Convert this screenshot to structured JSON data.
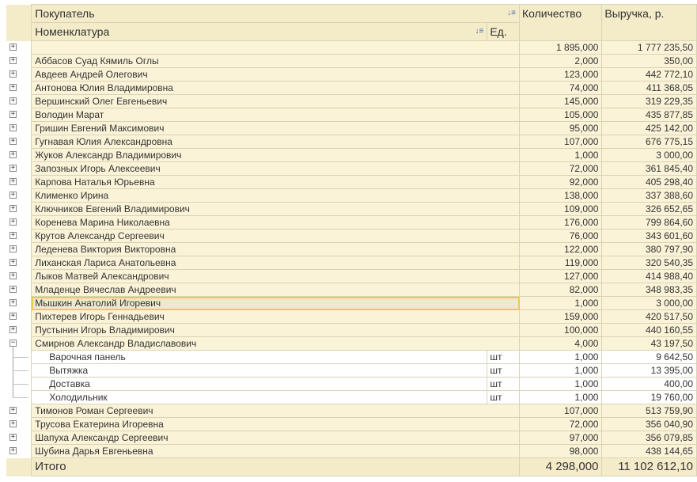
{
  "header": {
    "buyer": "Покупатель",
    "item": "Номенклатура",
    "unit": "Ед.",
    "qty": "Количество",
    "revenue": "Выручка, р."
  },
  "top_row": {
    "qty": "1 895,000",
    "revenue": "1 777 235,50"
  },
  "groups_before": [
    {
      "name": "Аббасов Суад Кямиль Оглы",
      "qty": "2,000",
      "revenue": "350,00"
    },
    {
      "name": "Авдеев Андрей Олегович",
      "qty": "123,000",
      "revenue": "442 772,10"
    },
    {
      "name": "Антонова Юлия Владимировна",
      "qty": "74,000",
      "revenue": "411 368,05"
    },
    {
      "name": "Вершинский Олег Евгеньевич",
      "qty": "145,000",
      "revenue": "319 229,35"
    },
    {
      "name": "Володин Марат",
      "qty": "105,000",
      "revenue": "435 877,85"
    },
    {
      "name": "Гришин Евгений Максимович",
      "qty": "95,000",
      "revenue": "425 142,00"
    },
    {
      "name": "Гугнавая Юлия Александровна",
      "qty": "107,000",
      "revenue": "676 775,15"
    },
    {
      "name": "Жуков Александр Владимирович",
      "qty": "1,000",
      "revenue": "3 000,00"
    },
    {
      "name": "Запозных Игорь Алексеевич",
      "qty": "72,000",
      "revenue": "361 845,40"
    },
    {
      "name": "Карпова Наталья Юрьевна",
      "qty": "92,000",
      "revenue": "405 298,40"
    },
    {
      "name": "Клименко Ирина",
      "qty": "138,000",
      "revenue": "337 388,60"
    },
    {
      "name": "Ключников Евгений Владимирович",
      "qty": "109,000",
      "revenue": "326 652,65"
    },
    {
      "name": "Коренева Марина Николаевна",
      "qty": "176,000",
      "revenue": "799 864,60"
    },
    {
      "name": "Крутов Александр Сергеевич",
      "qty": "76,000",
      "revenue": "343 601,60"
    },
    {
      "name": "Леденева Виктория Викторовна",
      "qty": "122,000",
      "revenue": "380 797,90"
    },
    {
      "name": "Лиханская Лариса Анатольевна",
      "qty": "119,000",
      "revenue": "320 540,35"
    },
    {
      "name": "Лыков Матвей Александрович",
      "qty": "127,000",
      "revenue": "414 988,40"
    },
    {
      "name": "Младенце Вячеслав Андреевич",
      "qty": "82,000",
      "revenue": "348 983,35"
    },
    {
      "name": "Мышкин Анатолий Игоревич",
      "qty": "1,000",
      "revenue": "3 000,00",
      "selected": true
    },
    {
      "name": "Пихтерев Игорь Геннадьевич",
      "qty": "159,000",
      "revenue": "420 517,50"
    },
    {
      "name": "Пустынин Игорь Владимирович",
      "qty": "100,000",
      "revenue": "440 160,55"
    }
  ],
  "expanded_group": {
    "name": "Смирнов Александр Владиславович",
    "qty": "4,000",
    "revenue": "43 197,50",
    "items": [
      {
        "name": "Варочная панель",
        "unit": "шт",
        "qty": "1,000",
        "revenue": "9 642,50"
      },
      {
        "name": "Вытяжка",
        "unit": "шт",
        "qty": "1,000",
        "revenue": "13 395,00"
      },
      {
        "name": "Доставка",
        "unit": "шт",
        "qty": "1,000",
        "revenue": "400,00"
      },
      {
        "name": "Холодильник",
        "unit": "шт",
        "qty": "1,000",
        "revenue": "19 760,00"
      }
    ]
  },
  "groups_after": [
    {
      "name": "Тимонов Роман Сергеевич",
      "qty": "107,000",
      "revenue": "513 759,90"
    },
    {
      "name": "Трусова Екатерина Игоревна",
      "qty": "72,000",
      "revenue": "356 040,90"
    },
    {
      "name": "Шапуха Александр Сергеевич",
      "qty": "97,000",
      "revenue": "356 079,85"
    },
    {
      "name": "Шубина Дарья Евгеньевна",
      "qty": "98,000",
      "revenue": "438 144,65"
    }
  ],
  "total": {
    "label": "Итого",
    "qty": "4 298,000",
    "revenue": "11 102 612,10"
  },
  "icons": {
    "expand": "plus-box-icon",
    "collapse": "minus-box-icon",
    "sort": "sort-icon"
  }
}
